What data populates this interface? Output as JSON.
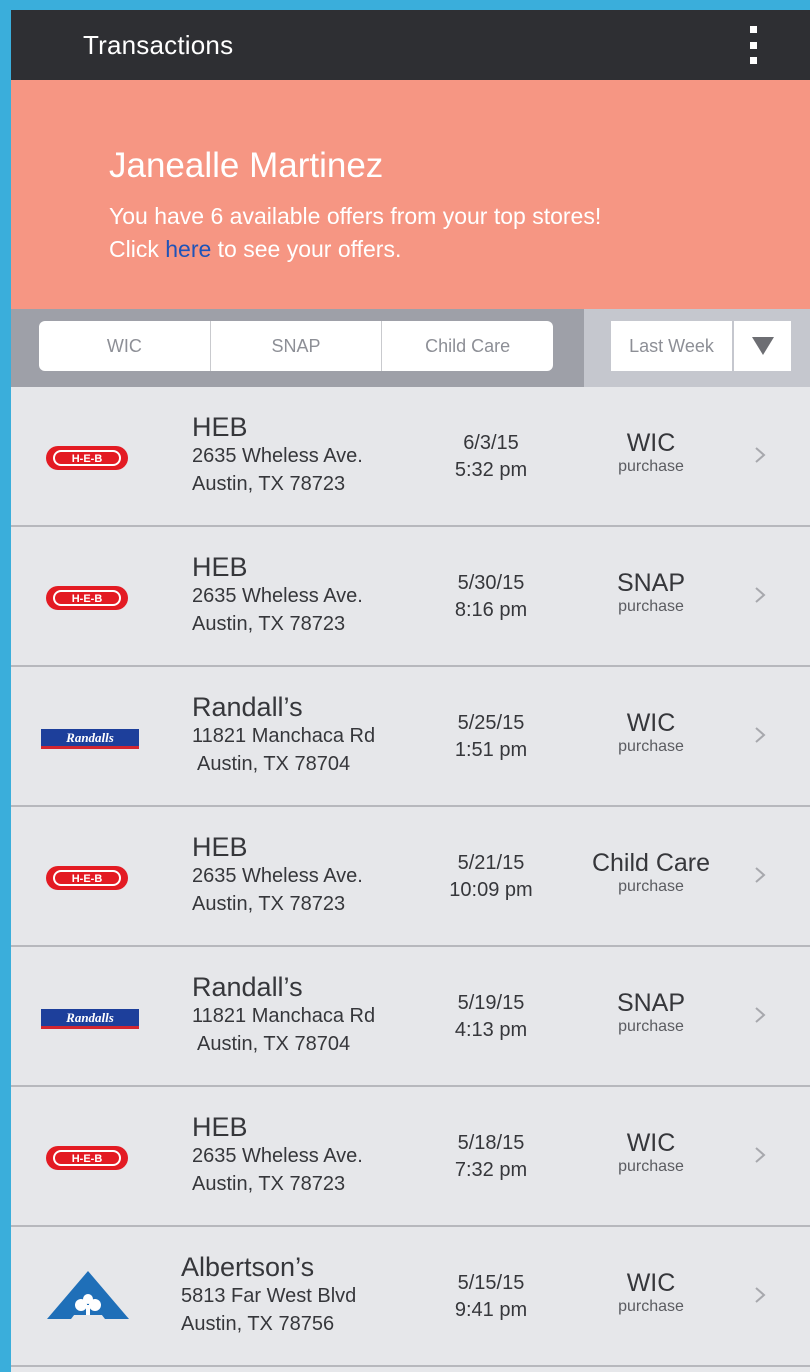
{
  "appbar": {
    "title": "Transactions",
    "menu_icon": "more-vert-icon"
  },
  "banner": {
    "name": "Janealle Martinez",
    "line1": "You have 6 available offers from your top stores!",
    "line2_prefix": "Click ",
    "line2_link": "here",
    "line2_suffix": " to see your offers."
  },
  "filters": {
    "segments": [
      "WIC",
      "SNAP",
      "Child Care"
    ],
    "period": "Last Week",
    "period_icon": "dropdown-triangle-icon"
  },
  "transactions": [
    {
      "logo": "heb",
      "logo_text": "H-E-B",
      "store": "HEB",
      "address1": "2635 Wheless Ave.",
      "address2": "Austin, TX 78723",
      "date": "6/3/15",
      "time": "5:32 pm",
      "type": "WIC",
      "sub": "purchase"
    },
    {
      "logo": "heb",
      "logo_text": "H-E-B",
      "store": "HEB",
      "address1": "2635 Wheless Ave.",
      "address2": "Austin, TX 78723",
      "date": "5/30/15",
      "time": "8:16 pm",
      "type": "SNAP",
      "sub": "purchase"
    },
    {
      "logo": "randalls",
      "logo_text": "Randalls",
      "store": "Randall’s",
      "address1": "11821 Manchaca Rd",
      "address2": "Austin, TX 78704",
      "date": "5/25/15",
      "time": "1:51 pm",
      "type": "WIC",
      "sub": "purchase"
    },
    {
      "logo": "heb",
      "logo_text": "H-E-B",
      "store": "HEB",
      "address1": "2635 Wheless Ave.",
      "address2": "Austin, TX 78723",
      "date": "5/21/15",
      "time": "10:09 pm",
      "type": "Child Care",
      "sub": "purchase"
    },
    {
      "logo": "randalls",
      "logo_text": "Randalls",
      "store": "Randall’s",
      "address1": "11821 Manchaca Rd",
      "address2": "Austin, TX 78704",
      "date": "5/19/15",
      "time": "4:13 pm",
      "type": "SNAP",
      "sub": "purchase"
    },
    {
      "logo": "heb",
      "logo_text": "H-E-B",
      "store": "HEB",
      "address1": "2635 Wheless Ave.",
      "address2": "Austin, TX 78723",
      "date": "5/18/15",
      "time": "7:32 pm",
      "type": "WIC",
      "sub": "purchase"
    },
    {
      "logo": "albertsons",
      "logo_text": "",
      "store": "Albertson’s",
      "address1": "5813 Far West Blvd",
      "address2": "Austin, TX 78756",
      "date": "5/15/15",
      "time": "9:41 pm",
      "type": "WIC",
      "sub": "purchase"
    }
  ],
  "colors": {
    "appbar": "#2e2f33",
    "banner": "#f69683",
    "link": "#1f53b8",
    "list_bg": "#e6e7ea",
    "heb_red": "#e31b23",
    "randalls_blue": "#1d3f9b",
    "albertsons_blue": "#1f6fb8"
  }
}
